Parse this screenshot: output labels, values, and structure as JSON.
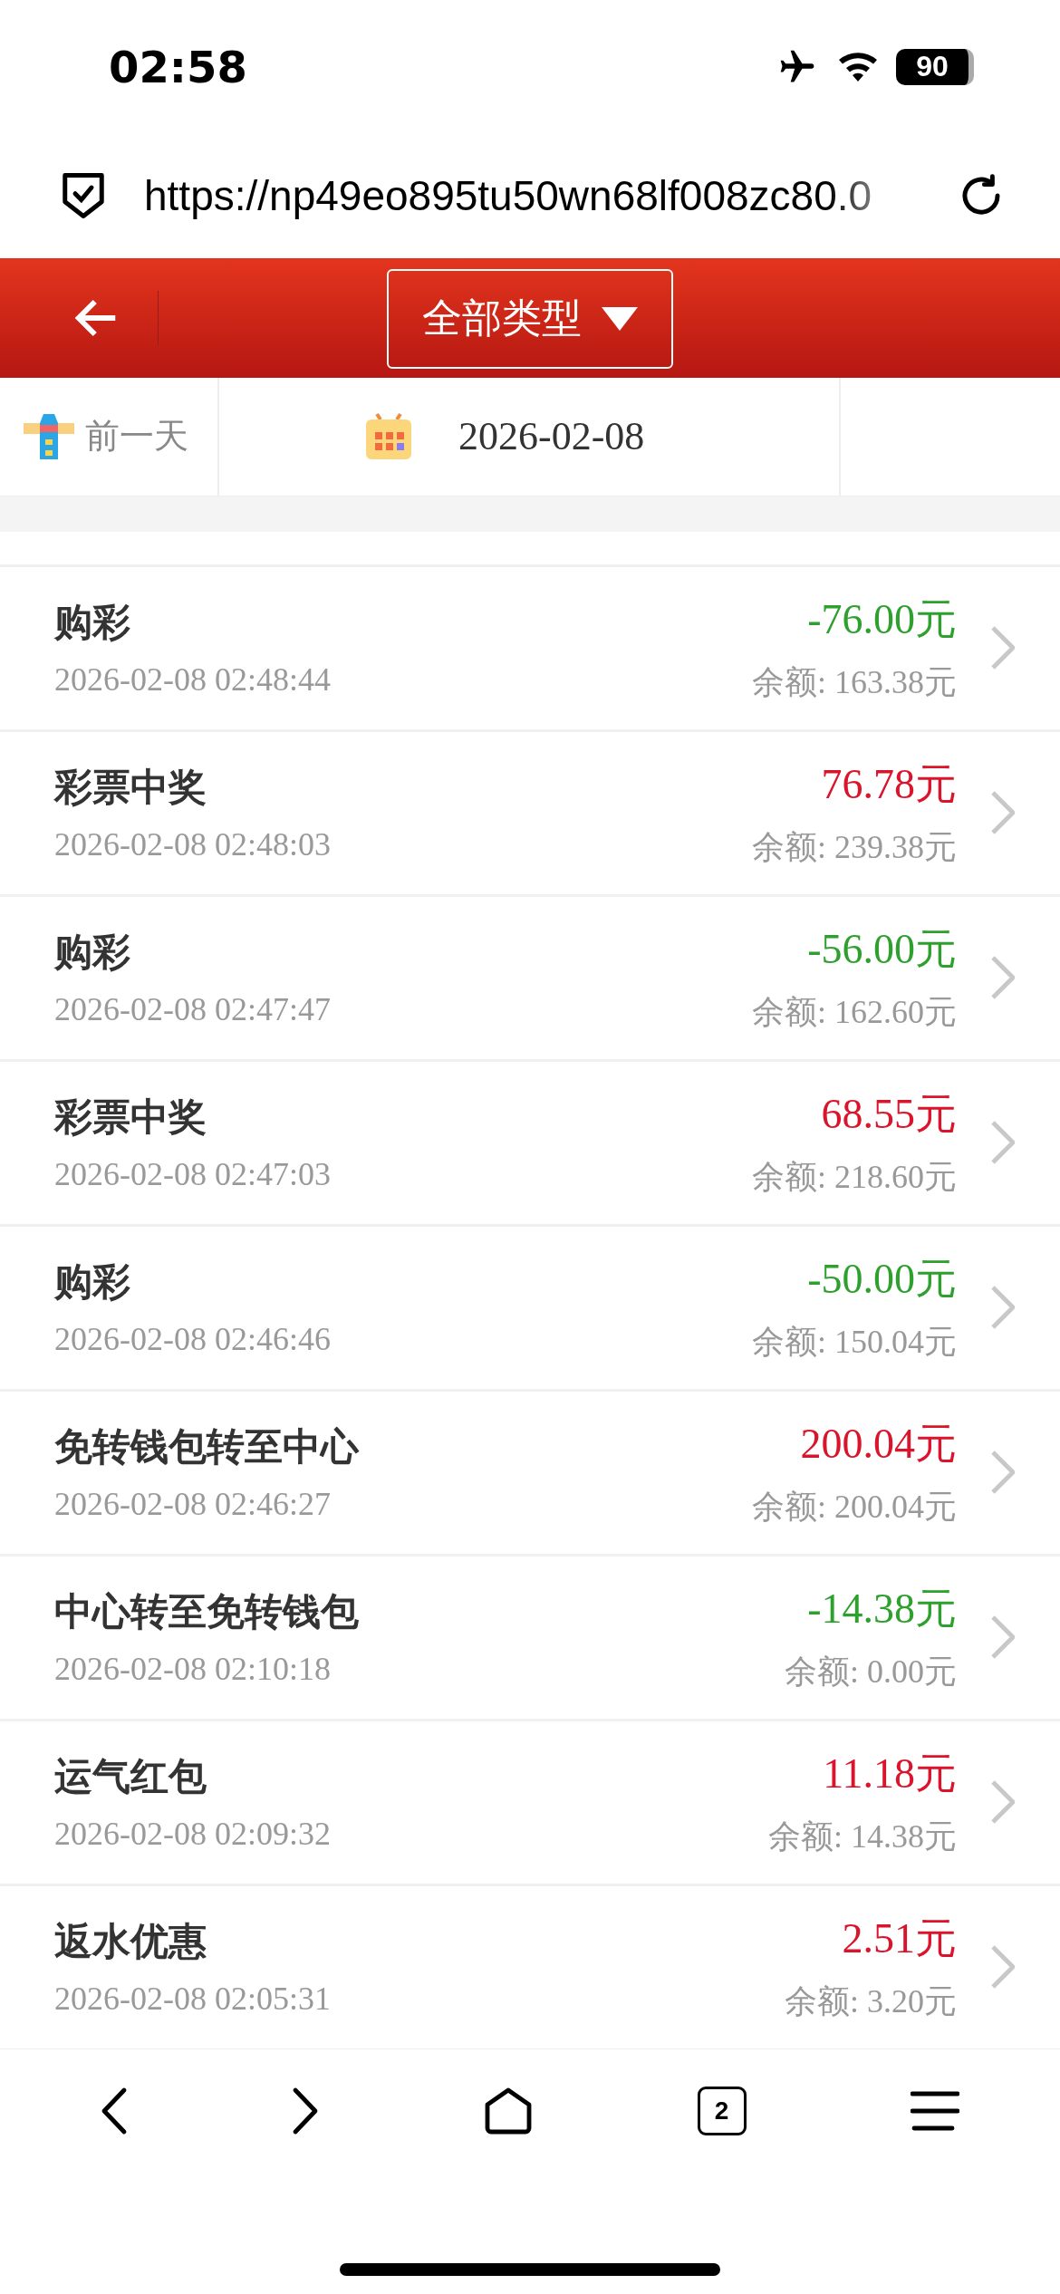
{
  "status_bar": {
    "time": "02:58",
    "battery": "90"
  },
  "address_bar": {
    "url": "https://np49eo895tu50wn68lf008zc80.0"
  },
  "header": {
    "filter": "全部类型"
  },
  "date_bar": {
    "prev_day": "前一天",
    "date": "2026-02-08"
  },
  "transactions": [
    {
      "title": "购彩",
      "time": "2026-02-08 02:48:44",
      "amount": "-76.00元",
      "color": "#2ea02e",
      "balance": "余额: 163.38元"
    },
    {
      "title": "彩票中奖",
      "time": "2026-02-08 02:48:03",
      "amount": "76.78元",
      "color": "#d9142b",
      "balance": "余额: 239.38元"
    },
    {
      "title": "购彩",
      "time": "2026-02-08 02:47:47",
      "amount": "-56.00元",
      "color": "#2ea02e",
      "balance": "余额: 162.60元"
    },
    {
      "title": "彩票中奖",
      "time": "2026-02-08 02:47:03",
      "amount": "68.55元",
      "color": "#d9142b",
      "balance": "余额: 218.60元"
    },
    {
      "title": "购彩",
      "time": "2026-02-08 02:46:46",
      "amount": "-50.00元",
      "color": "#2ea02e",
      "balance": "余额: 150.04元"
    },
    {
      "title": "免转钱包转至中心",
      "time": "2026-02-08 02:46:27",
      "amount": "200.04元",
      "color": "#d9142b",
      "balance": "余额: 200.04元"
    },
    {
      "title": "中心转至免转钱包",
      "time": "2026-02-08 02:10:18",
      "amount": "-14.38元",
      "color": "#2ea02e",
      "balance": "余额: 0.00元"
    },
    {
      "title": "运气红包",
      "time": "2026-02-08 02:09:32",
      "amount": "11.18元",
      "color": "#d9142b",
      "balance": "余额: 14.38元"
    },
    {
      "title": "返水优惠",
      "time": "2026-02-08 02:05:31",
      "amount": "2.51元",
      "color": "#d9142b",
      "balance": "余额: 3.20元"
    }
  ],
  "toolbar": {
    "tab_count": "2"
  }
}
